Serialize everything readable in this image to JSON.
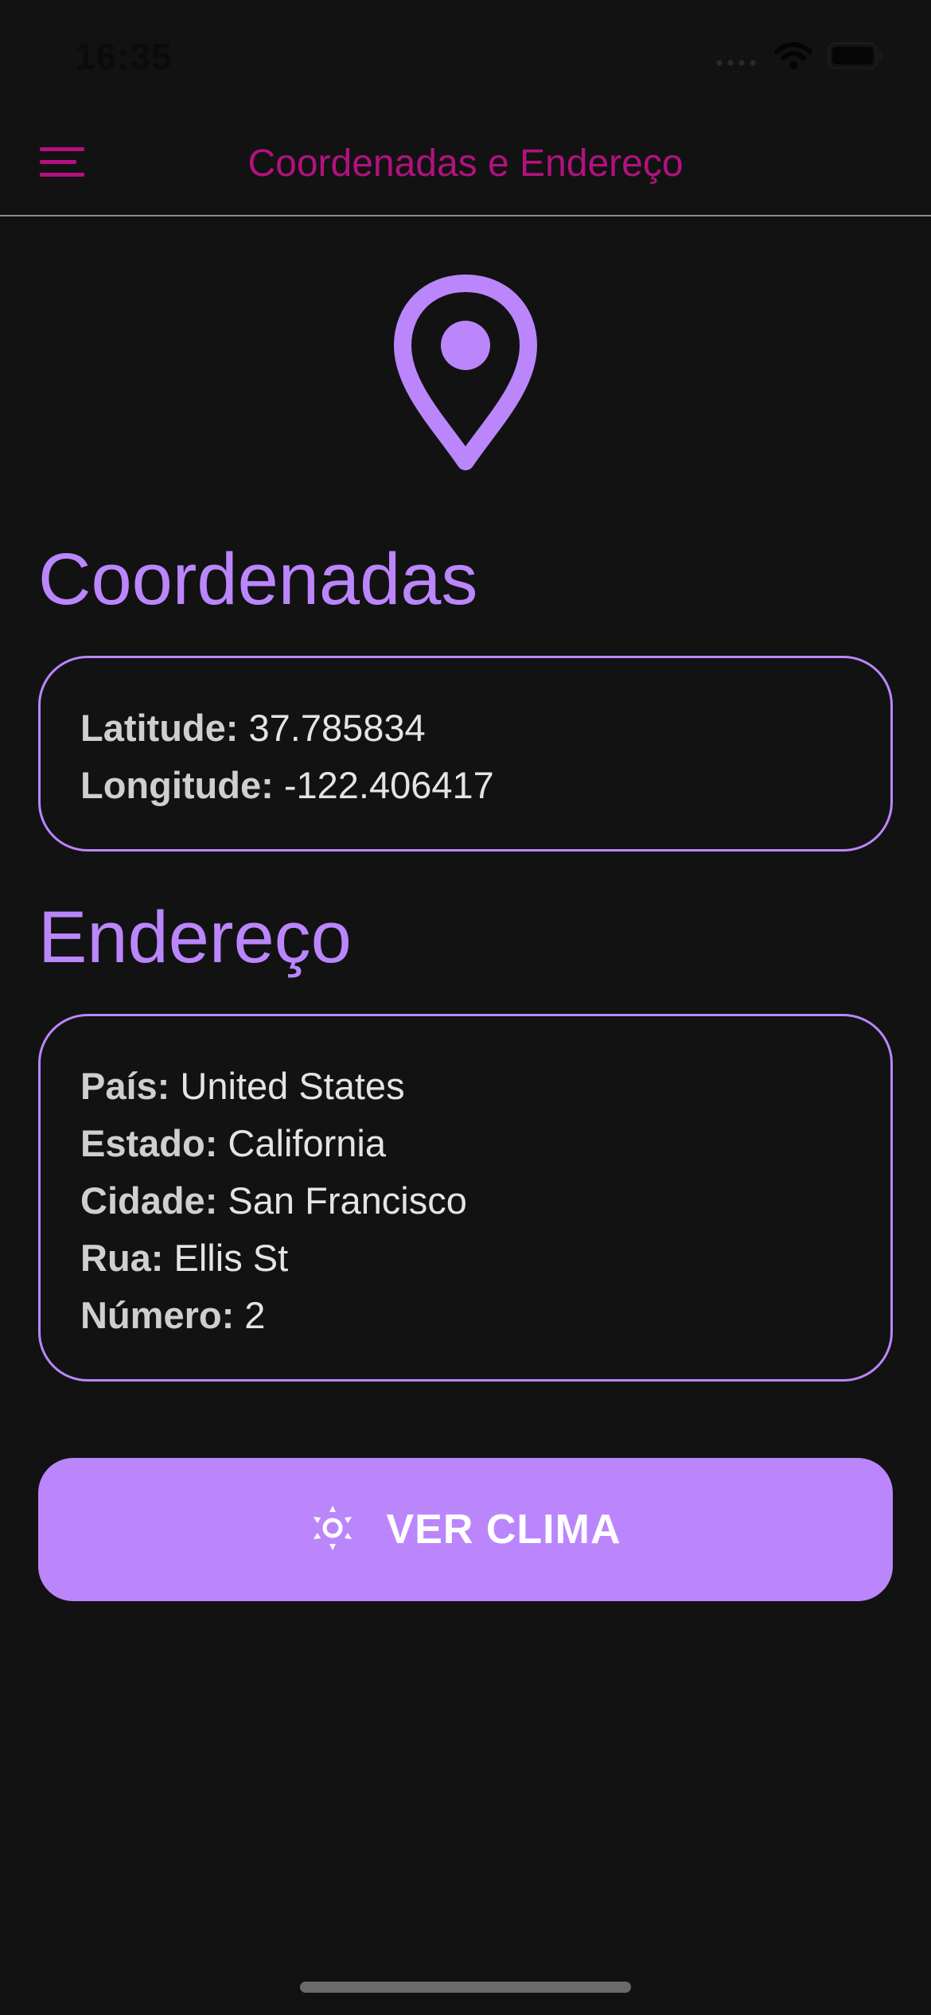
{
  "status_bar": {
    "time": "16:35",
    "icons": [
      "cellular-signal-icon",
      "wifi-icon",
      "battery-icon"
    ]
  },
  "app_bar": {
    "menu_icon": "hamburger-menu-icon",
    "title": "Coordenadas e Endereço",
    "title_color": "#b3117e"
  },
  "hero": {
    "icon": "location-pin-icon",
    "color": "#bb86fc"
  },
  "coordinates": {
    "title": "Coordenadas",
    "latitude_label": "Latitude:",
    "latitude_value": "37.785834",
    "longitude_label": "Longitude:",
    "longitude_value": "-122.406417"
  },
  "address": {
    "title": "Endereço",
    "fields": [
      {
        "label": "País:",
        "value": "United States"
      },
      {
        "label": "Estado:",
        "value": "California"
      },
      {
        "label": "Cidade:",
        "value": "San Francisco"
      },
      {
        "label": "Rua:",
        "value": "Ellis St"
      },
      {
        "label": "Número:",
        "value": "2"
      }
    ]
  },
  "weather_button": {
    "icon": "sun-icon",
    "label": "VER CLIMA"
  },
  "colors": {
    "background": "#121213",
    "accent": "#bb86fc",
    "title_accent": "#b3117e"
  }
}
